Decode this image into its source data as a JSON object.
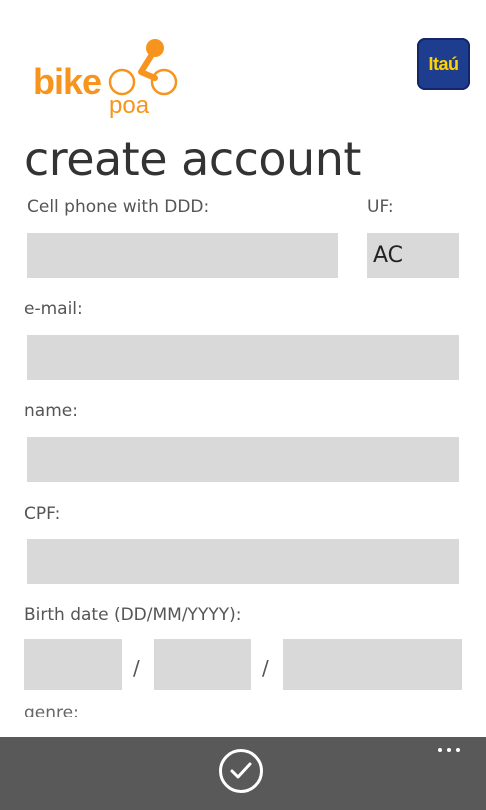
{
  "header": {
    "logo_main": "bike",
    "logo_sub": "poa",
    "partner_logo": "Itaú",
    "title": "create account"
  },
  "form": {
    "cell_label": "Cell phone with DDD:",
    "uf_label": "UF:",
    "uf_value": "AC",
    "email_label": "e-mail:",
    "name_label": "name:",
    "cpf_label": "CPF:",
    "birth_label": "Birth date (DD/MM/YYYY):",
    "date_separator": "/",
    "gender_label": "genre:"
  },
  "appbar": {
    "confirm_icon": "check-circle-icon",
    "more_icon": "more-dots-icon"
  },
  "colors": {
    "brand_orange": "#f7941d",
    "itau_blue": "#1e3d8f",
    "itau_yellow": "#ffd200",
    "field_gray": "#d9d9d9",
    "appbar_gray": "#595959"
  }
}
